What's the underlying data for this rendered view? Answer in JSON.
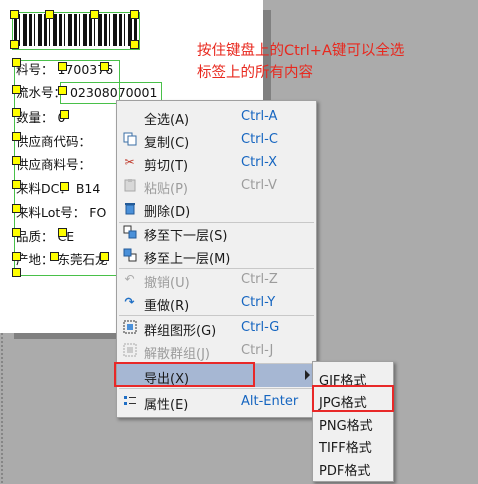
{
  "label": {
    "fields": [
      {
        "key": "label-part-no",
        "text": "料号：  1700376"
      },
      {
        "key": "label-serial",
        "text": "流水号：  02308070001"
      },
      {
        "key": "label-qty",
        "text": "数量：  0"
      },
      {
        "key": "label-supplier-code",
        "text": "供应商代码："
      },
      {
        "key": "label-supplier-part",
        "text": "供应商料号："
      },
      {
        "key": "label-dc",
        "text": "来料DC：  B14"
      },
      {
        "key": "label-lot",
        "text": "来料Lot号：  FO"
      },
      {
        "key": "label-item",
        "text": "品质：  CE"
      },
      {
        "key": "label-origin",
        "text": "产地：  东莞石龙"
      }
    ]
  },
  "annotation": {
    "text": "按住键盘上的Ctrl+A键可以全选标签上的所有内容"
  },
  "context_menu": {
    "items": [
      {
        "name": "menu-select-all",
        "icon": "",
        "label": "全选(A)",
        "shortcut": "Ctrl-A",
        "disabled": false
      },
      {
        "name": "menu-copy",
        "icon": "copy-icon",
        "label": "复制(C)",
        "shortcut": "Ctrl-C",
        "disabled": false
      },
      {
        "name": "menu-cut",
        "icon": "scissors-icon",
        "label": "剪切(T)",
        "shortcut": "Ctrl-X",
        "disabled": false
      },
      {
        "name": "menu-paste",
        "icon": "paste-icon",
        "label": "粘贴(P)",
        "shortcut": "Ctrl-V",
        "disabled": true
      },
      {
        "name": "menu-delete",
        "icon": "trash-icon",
        "label": "删除(D)",
        "shortcut": "",
        "disabled": false
      },
      {
        "name": "menu-move-down",
        "icon": "layer-down-icon",
        "label": "移至下一层(S)",
        "shortcut": "",
        "disabled": false
      },
      {
        "name": "menu-move-up",
        "icon": "layer-up-icon",
        "label": "移至上一层(M)",
        "shortcut": "",
        "disabled": false
      },
      {
        "name": "menu-undo",
        "icon": "undo-icon",
        "label": "撤销(U)",
        "shortcut": "Ctrl-Z",
        "disabled": true
      },
      {
        "name": "menu-redo",
        "icon": "redo-icon",
        "label": "重做(R)",
        "shortcut": "Ctrl-Y",
        "disabled": false
      },
      {
        "name": "menu-group",
        "icon": "group-icon",
        "label": "群组图形(G)",
        "shortcut": "Ctrl-G",
        "disabled": false
      },
      {
        "name": "menu-ungroup",
        "icon": "ungroup-icon",
        "label": "解散群组(J)",
        "shortcut": "Ctrl-J",
        "disabled": true
      },
      {
        "name": "menu-export",
        "icon": "",
        "label": "导出(X)",
        "shortcut": "",
        "disabled": false
      },
      {
        "name": "menu-properties",
        "icon": "properties-icon",
        "label": "属性(E)",
        "shortcut": "Alt-Enter",
        "disabled": false
      }
    ]
  },
  "export_submenu": {
    "items": [
      {
        "name": "submenu-gif",
        "label": "GIF格式"
      },
      {
        "name": "submenu-jpg",
        "label": "JPG格式"
      },
      {
        "name": "submenu-png",
        "label": "PNG格式"
      },
      {
        "name": "submenu-tiff",
        "label": "TIFF格式"
      },
      {
        "name": "submenu-pdf",
        "label": "PDF格式"
      }
    ]
  },
  "colors": {
    "highlight": "#a6b7d3",
    "shortcut": "#1565c0",
    "annotation": "#e8281e",
    "callout_box": "#e82828",
    "handle": "#ffff00",
    "canvas_bg": "#ababab"
  }
}
